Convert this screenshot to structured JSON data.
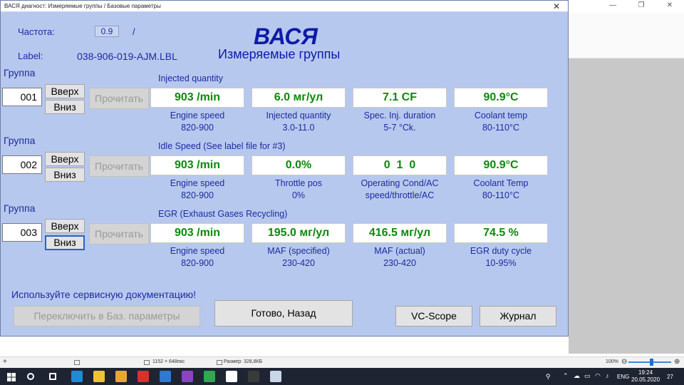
{
  "window": {
    "title": "ВАСЯ диагност: Измеряемые группы / Базовые параметры",
    "close_glyph": "✕"
  },
  "header": {
    "freq_label": "Частота:",
    "freq_value": "0.9",
    "freq_slash": "/",
    "label_label": "Label:",
    "label_value": "038-906-019-AJM.LBL",
    "app_title": "ВАСЯ",
    "app_subtitle": "Измеряемые группы"
  },
  "groups": [
    {
      "word": "Группа",
      "number": "001",
      "up": "Вверх",
      "down": "Вниз",
      "read": "Прочитать",
      "caption": "Injected quantity",
      "cells": [
        {
          "value": "903 /min",
          "name": "Engine speed",
          "range": "820-900"
        },
        {
          "value": "6.0 мг/ул",
          "name": "Injected quantity",
          "range": "3.0-11.0"
        },
        {
          "value": "7.1 CF",
          "name": "Spec. Inj. duration",
          "range": "5-7 °Ck."
        },
        {
          "value": "90.9°C",
          "name": "Coolant temp",
          "range": "80-110°C"
        }
      ]
    },
    {
      "word": "Группа",
      "number": "002",
      "up": "Вверх",
      "down": "Вниз",
      "read": "Прочитать",
      "caption": "Idle Speed (See label file for #3)",
      "cells": [
        {
          "value": "903 /min",
          "name": "Engine speed",
          "range": "820-900"
        },
        {
          "value": "0.0%",
          "name": "Throttle pos",
          "range": "0%"
        },
        {
          "value": "0  1  0",
          "name": "Operating Cond/AC",
          "range": "speed/throttle/AC"
        },
        {
          "value": "90.9°C",
          "name": "Coolant Temp",
          "range": "80-110°C"
        }
      ]
    },
    {
      "word": "Группа",
      "number": "003",
      "up": "Вверх",
      "down": "Вниз",
      "read": "Прочитать",
      "caption": "EGR (Exhaust Gases Recycling)",
      "cells": [
        {
          "value": "903 /min",
          "name": "Engine speed",
          "range": "820-900"
        },
        {
          "value": "195.0 мг/ул",
          "name": "MAF (specified)",
          "range": "230-420"
        },
        {
          "value": "416.5 мг/ул",
          "name": "MAF (actual)",
          "range": "230-420"
        },
        {
          "value": "74.5 %",
          "name": "EGR duty cycle",
          "range": "10-95%"
        }
      ]
    }
  ],
  "footer": {
    "hint": "Используйте сервисную документацию!",
    "basic_params": "Переключить в Баз. параметры",
    "done_back": "Готово, Назад",
    "vc_scope": "VC-Scope",
    "journal": "Журнал"
  },
  "background_app": {
    "window_buttons": [
      "—",
      "❐",
      "✕"
    ],
    "status_size": "1152 × 648пкс",
    "status_filesize": "Размер: 328,8КБ",
    "zoom": "100%"
  },
  "taskbar": {
    "lang": "ENG",
    "time": "19:24",
    "date": "20.05.2020",
    "notif_count": "27",
    "app_icons": [
      "search-icon",
      "task-view-icon",
      "edge-icon",
      "explorer-icon",
      "store-icon",
      "gift-icon",
      "mail-icon",
      "save-icon",
      "chrome-icon",
      "settings-icon",
      "vasya-icon",
      "paint-icon"
    ],
    "colors": [
      "#ffffff",
      "#ffffff",
      "#1f8bd8",
      "#f2c230",
      "#e8a735",
      "#d9312b",
      "#2d7ad2",
      "#8a44c2",
      "#2fa84f",
      "#ffffff",
      "#3a3a3a",
      "#c9d6e8"
    ]
  }
}
